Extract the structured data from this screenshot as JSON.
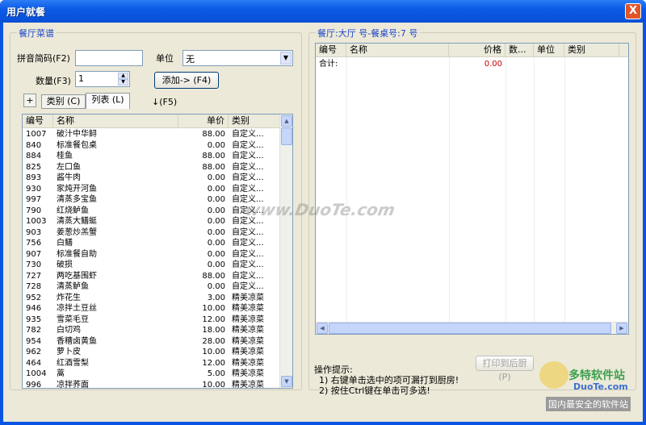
{
  "window": {
    "title": "用户就餐",
    "close_symbol": "X"
  },
  "left_group": {
    "title": "餐厅菜谱"
  },
  "form": {
    "pinyin_label": "拼音简码(F2)",
    "pinyin_value": "",
    "unit_label": "单位",
    "unit_value": "无",
    "qty_label": "数量(F3)",
    "qty_value": "1",
    "add_button": "添加-> (F4)",
    "f5_label": "↓(F5)"
  },
  "tabs": {
    "plus": "+",
    "category": "类别 (C)",
    "list": "列表 (L)"
  },
  "menu_table": {
    "columns": [
      "编号",
      "名称",
      "单价",
      "类别"
    ],
    "rows": [
      [
        "1007",
        "破汁中华鲟",
        "88.00",
        "自定义..."
      ],
      [
        "840",
        "标准餐包桌",
        "0.00",
        "自定义..."
      ],
      [
        "884",
        "桂鱼",
        "88.00",
        "自定义..."
      ],
      [
        "825",
        "左口鱼",
        "88.00",
        "自定义..."
      ],
      [
        "893",
        "酱牛肉",
        "0.00",
        "自定义..."
      ],
      [
        "930",
        "家炖开河鱼",
        "0.00",
        "自定义..."
      ],
      [
        "997",
        "清蒸多宝鱼",
        "0.00",
        "自定义..."
      ],
      [
        "790",
        "红烧鲈鱼",
        "0.00",
        "自定义..."
      ],
      [
        "1003",
        "清蒸大鳝蜓",
        "0.00",
        "自定义..."
      ],
      [
        "903",
        "姜葱炒羔蟹",
        "0.00",
        "自定义..."
      ],
      [
        "756",
        "白鳝",
        "0.00",
        "自定义..."
      ],
      [
        "907",
        "标准餐自助",
        "0.00",
        "自定义..."
      ],
      [
        "730",
        "破损",
        "0.00",
        "自定义..."
      ],
      [
        "727",
        "两吃基围虾",
        "88.00",
        "自定义..."
      ],
      [
        "728",
        "清蒸鲈鱼",
        "0.00",
        "自定义..."
      ],
      [
        "952",
        "炸花生",
        "3.00",
        "精美凉菜"
      ],
      [
        "946",
        "凉拌土豆丝",
        "10.00",
        "精美凉菜"
      ],
      [
        "935",
        "雪菜毛豆",
        "12.00",
        "精美凉菜"
      ],
      [
        "782",
        "白切鸡",
        "18.00",
        "精美凉菜"
      ],
      [
        "954",
        "香糟卤黄鱼",
        "28.00",
        "精美凉菜"
      ],
      [
        "962",
        "萝卜皮",
        "10.00",
        "精美凉菜"
      ],
      [
        "464",
        "红酒雪梨",
        "12.00",
        "精美凉菜"
      ],
      [
        "1004",
        "蒿",
        "5.00",
        "精美凉菜"
      ],
      [
        "996",
        "凉拌荞面",
        "10.00",
        "精美凉菜"
      ]
    ]
  },
  "right_group": {
    "title": "餐厅:大厅 号-餐桌号:7 号"
  },
  "order_table": {
    "columns": [
      "编号",
      "名称",
      "价格",
      "数...",
      "单位",
      "类别"
    ],
    "total_label": "合计:",
    "total_value": "0.00"
  },
  "print_button": "打印到后厨(P)",
  "hints": {
    "title": "操作提示:",
    "line1": "1) 右键单击选中的项可漏打到厨房!",
    "line2": "2) 按住Ctrl键在单击可多选!"
  },
  "watermarks": {
    "center": "www.DuoTe.com",
    "logo_text": "多特软件站",
    "logo_sub": "DuoTe.com",
    "bottom": "国内最安全的软件站"
  }
}
